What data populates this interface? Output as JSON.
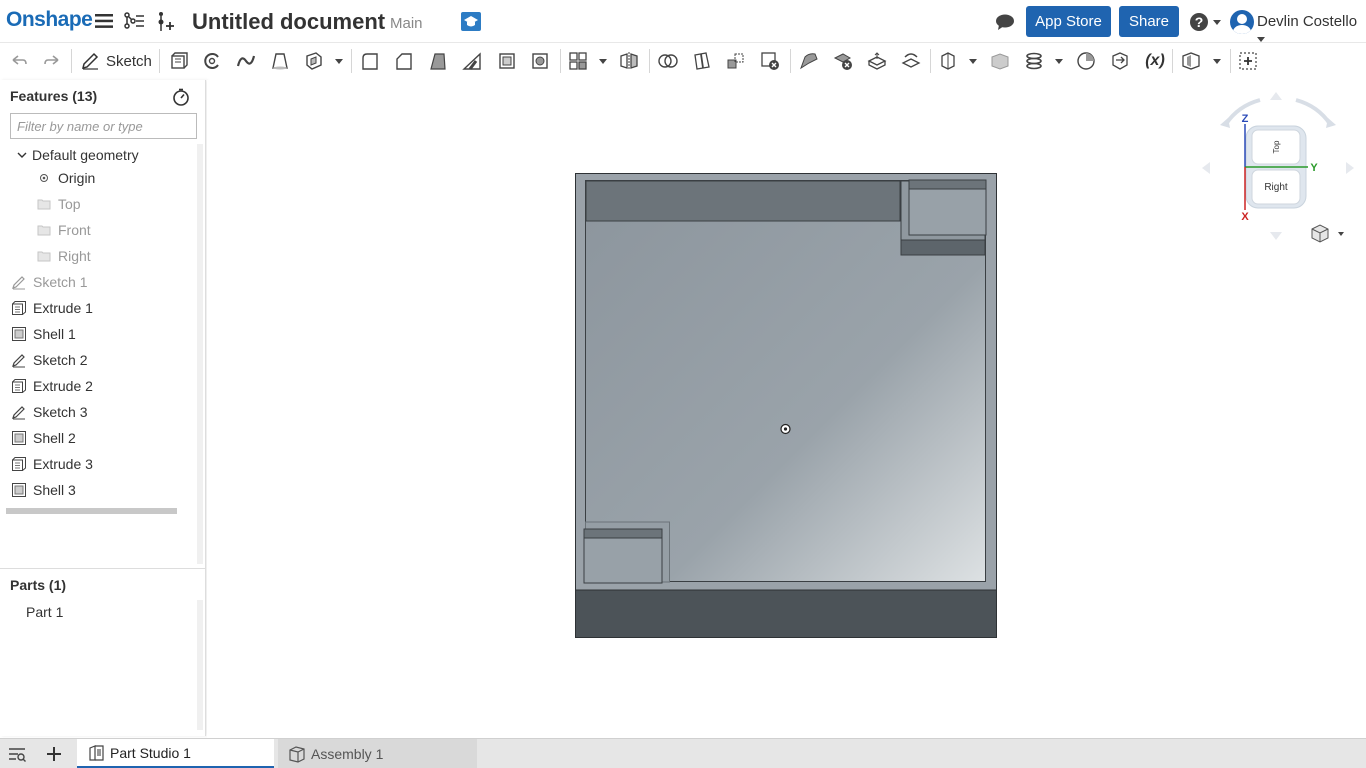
{
  "header": {
    "logo": "Onshape",
    "document_title": "Untitled document",
    "branch": "Main",
    "app_store_label": "App Store",
    "share_label": "Share",
    "help_label": "?",
    "user_name": "Devlin Costello"
  },
  "toolbar": {
    "sketch_label": "Sketch",
    "variable_label": "(x)"
  },
  "features": {
    "header": "Features (13)",
    "filter_placeholder": "Filter by name or type",
    "default_geometry_label": "Default geometry",
    "default_items": [
      {
        "label": "Origin"
      },
      {
        "label": "Top"
      },
      {
        "label": "Front"
      },
      {
        "label": "Right"
      }
    ],
    "items": [
      {
        "label": "Sketch 1",
        "icon": "sketch-icon"
      },
      {
        "label": "Extrude 1",
        "icon": "extrude-icon"
      },
      {
        "label": "Shell 1",
        "icon": "shell-icon"
      },
      {
        "label": "Sketch 2",
        "icon": "sketch-icon"
      },
      {
        "label": "Extrude 2",
        "icon": "extrude-icon"
      },
      {
        "label": "Sketch 3",
        "icon": "sketch-icon"
      },
      {
        "label": "Shell 2",
        "icon": "shell-icon"
      },
      {
        "label": "Extrude 3",
        "icon": "extrude-icon"
      },
      {
        "label": "Shell 3",
        "icon": "shell-icon"
      }
    ]
  },
  "parts": {
    "header": "Parts (1)",
    "items": [
      {
        "label": "Part 1"
      }
    ]
  },
  "viewcube": {
    "z_label": "Z",
    "y_label": "Y",
    "x_label": "X",
    "top_face": "Top",
    "right_face": "Right"
  },
  "tabs": [
    {
      "label": "Part Studio 1",
      "active": true
    },
    {
      "label": "Assembly 1",
      "active": false
    }
  ],
  "colors": {
    "brand": "#1a6bb6",
    "button": "#1f64b0",
    "model_face": "#8d979f",
    "model_dark": "#4e555b"
  }
}
